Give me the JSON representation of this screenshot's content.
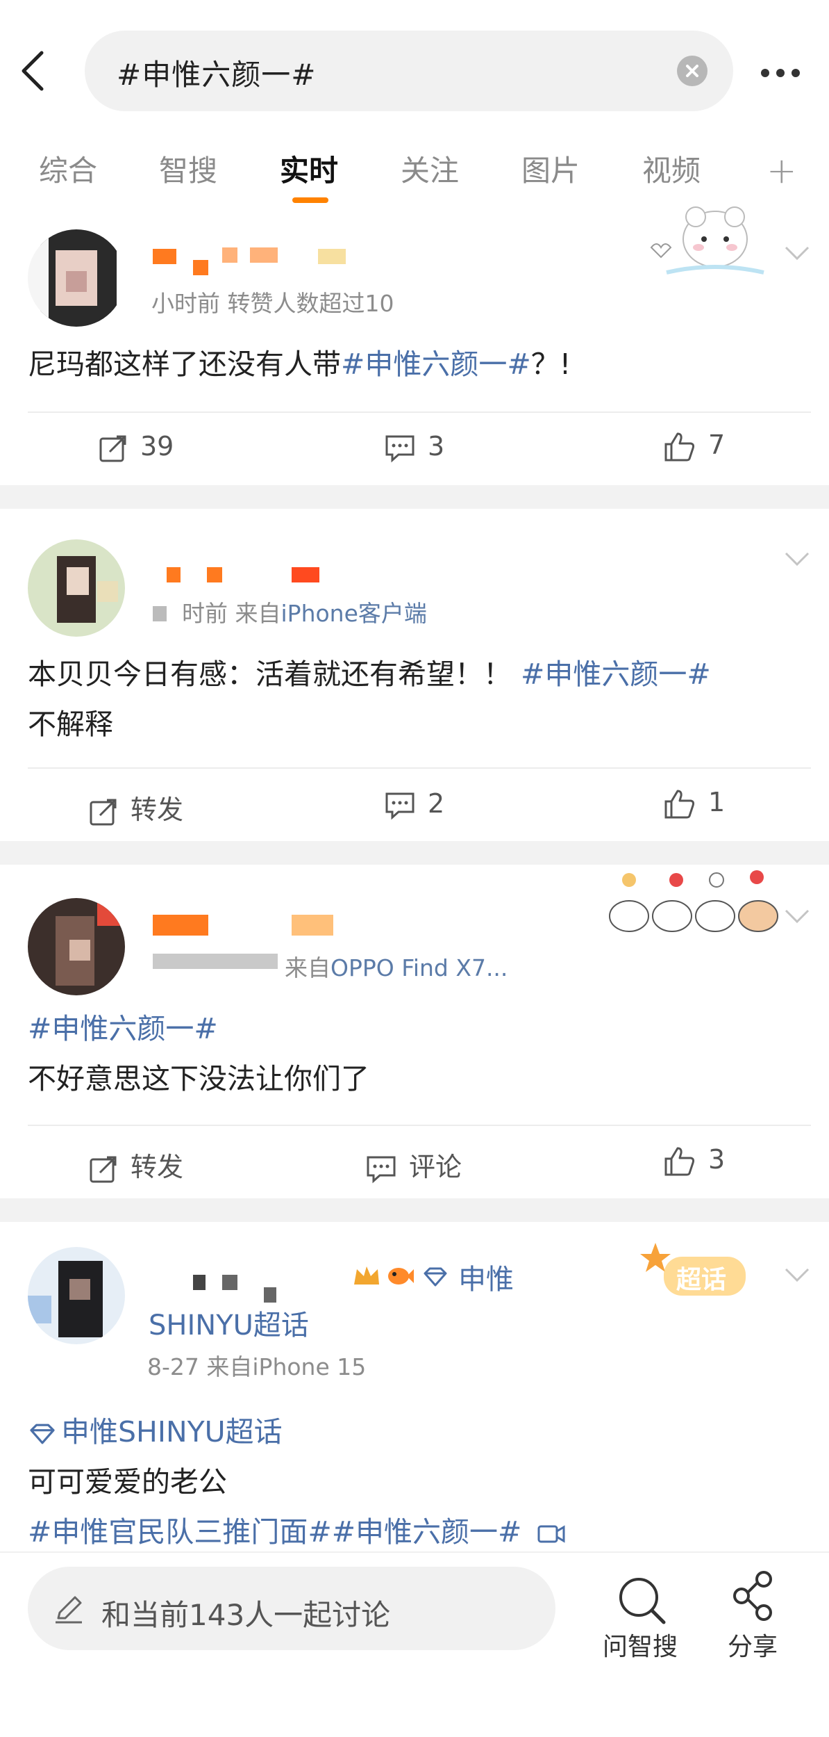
{
  "header": {
    "query": "#申惟六颜一#"
  },
  "tabs": [
    "综合",
    "智搜",
    "实时",
    "关注",
    "图片",
    "视频"
  ],
  "tabs_active": "实时",
  "posts": [
    {
      "meta": "小时前  转赞人数超过10",
      "text_plain": "尼玛都这样了还没有人带",
      "tag": "#申惟六颜一#",
      "text_after": "？!",
      "actions": {
        "repost": "39",
        "comment": "3",
        "like": "7"
      }
    },
    {
      "meta_prefix": "时前  来自",
      "meta_link": "iPhone客户端",
      "text_plain": "本贝贝今日有感：活着就还有希望！！",
      "tag": "#申惟六颜一#",
      "text_line2": "不解释",
      "actions": {
        "repost": "转发",
        "comment": "2",
        "like": "1"
      }
    },
    {
      "meta_prefix": "来自",
      "meta_link": "OPPO Find X7...",
      "tag_line": "#申惟六颜一#",
      "text_line2": "不好意思这下没法让你们了",
      "actions": {
        "repost": "转发",
        "comment": "评论",
        "like": "3"
      }
    },
    {
      "badge_text": "申惟",
      "name_line2": "SHINYU超话",
      "meta": "8-27  来自iPhone 15",
      "supertopic_badge": "超话",
      "supertopic": "申惟SHINYU超话",
      "text_line": "可可爱爱的老公",
      "tags_line": "#申惟官民队三推门面##申惟六颜一#"
    }
  ],
  "bottom": {
    "discuss_placeholder": "和当前143人一起讨论",
    "smart_search": "问智搜",
    "share": "分享"
  },
  "colors": {
    "accent": "#ff8200",
    "link": "#4a6fa8"
  }
}
